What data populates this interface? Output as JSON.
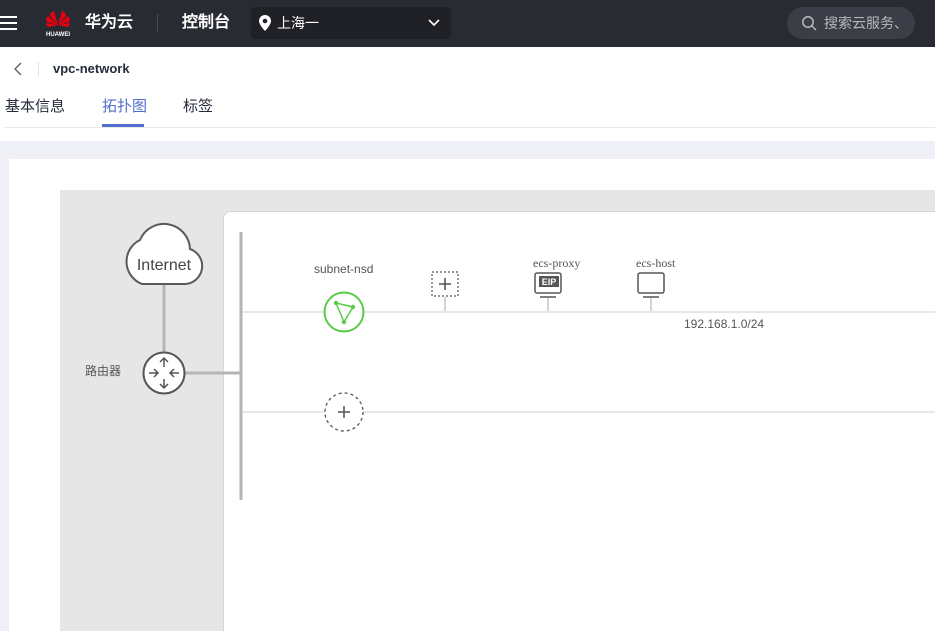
{
  "topbar": {
    "brand": "华为云",
    "logo_text": "HUAWEI",
    "console_label": "控制台",
    "region": "上海一",
    "search_placeholder": "搜索云服务、"
  },
  "header": {
    "title": "vpc-network",
    "tabs": [
      {
        "label": "基本信息",
        "active": false
      },
      {
        "label": "拓扑图",
        "active": true
      },
      {
        "label": "标签",
        "active": false
      }
    ]
  },
  "topology": {
    "internet_label": "Internet",
    "router_label": "路由器",
    "subnet_label": "subnet-nsd",
    "subnet_cidr": "192.168.1.0/24",
    "servers": [
      {
        "name": "ecs-proxy",
        "badge": "EIP"
      },
      {
        "name": "ecs-host",
        "badge": ""
      }
    ]
  },
  "colors": {
    "topbar_bg": "#292b33",
    "accent": "#526ecc",
    "subnet_green": "#5cc94b"
  },
  "icons": [
    "menu-icon",
    "huawei-logo-icon",
    "location-pin-icon",
    "chevron-down-icon",
    "search-icon",
    "back-icon",
    "cloud-icon",
    "router-icon",
    "subnet-icon",
    "add-icon",
    "server-eip-icon",
    "server-icon"
  ]
}
